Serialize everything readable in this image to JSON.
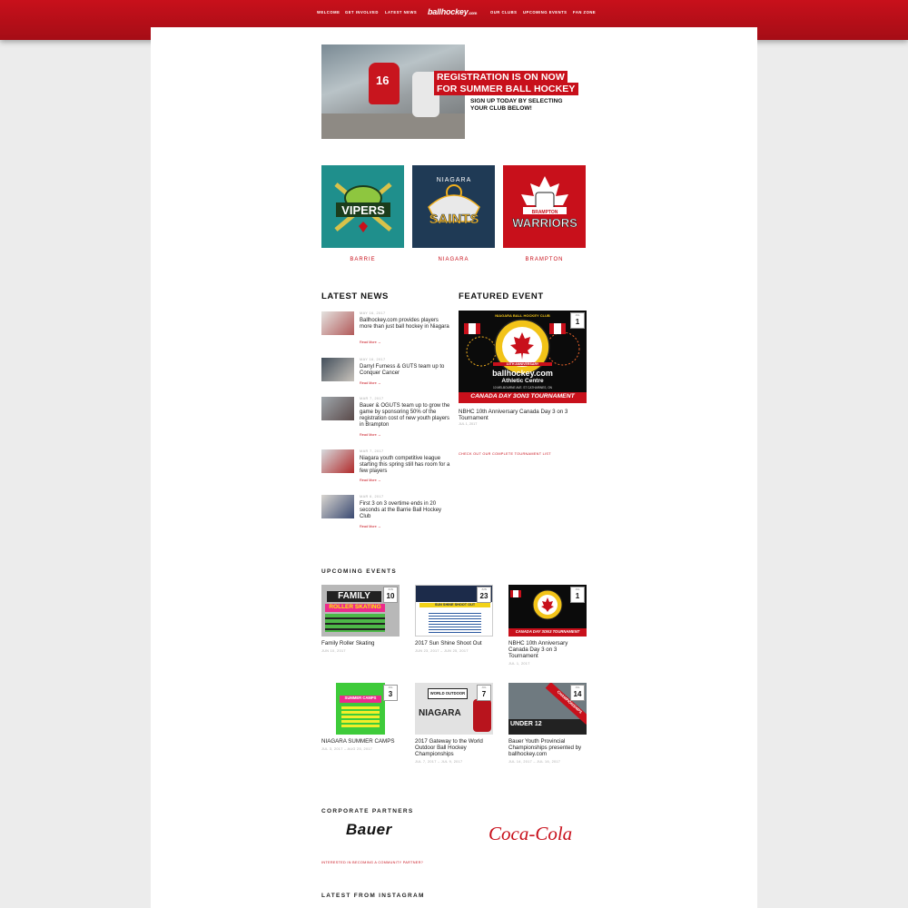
{
  "nav": {
    "left": [
      "WELCOME",
      "GET INVOLVED",
      "LATEST NEWS"
    ],
    "logo": "ballhockey",
    "logo_suffix": ".com",
    "right": [
      "OUR CLUBS",
      "UPCOMING EVENTS",
      "FAN ZONE"
    ]
  },
  "hero": {
    "line1": "REGISTRATION IS ON NOW",
    "line2": "FOR SUMMER BALL HOCKEY",
    "sub1": "SIGN UP TODAY BY SELECTING",
    "sub2": "YOUR CLUB BELOW!",
    "jersey_number": "16"
  },
  "clubs": [
    {
      "name": "BARRIE",
      "logo_text": "VIPERS",
      "bg": "#1f8f8c"
    },
    {
      "name": "NIAGARA",
      "logo_text": "SAINTS",
      "logo_top": "NIAGARA",
      "bg": "#1f3a55"
    },
    {
      "name": "BRAMPTON",
      "logo_text": "WARRIORS",
      "logo_top": "BRAMPTON",
      "bg": "#c8101b"
    }
  ],
  "latest_news": {
    "title": "LATEST NEWS",
    "items": [
      {
        "date": "MAY 16, 2017",
        "title": "Ballhockey.com provides players more than just ball hockey in Niagara",
        "more": "Read More →"
      },
      {
        "date": "MAY 16, 2017",
        "title": "Darryl Furness & GUTS team up to Conquer Cancer",
        "more": "Read More →"
      },
      {
        "date": "MAR 7, 2017",
        "title": "Bauer & OGUTS team up to grow the game by sponsoring 50% of the registration cost of new youth players in Brampton",
        "more": "Read More →"
      },
      {
        "date": "MAR 7, 2017",
        "title": "Niagara youth competitive league starting this spring still has room for a few players",
        "more": "Read More →"
      },
      {
        "date": "MAR 6, 2017",
        "title": "First 3 on 3 overtime ends in 20 seconds at the Barrie Ball Hockey Club",
        "more": "Read More →"
      }
    ]
  },
  "featured_event": {
    "title": "FEATURED EVENT",
    "badge_month": "JUL",
    "badge_day": "1",
    "poster_top": "NIAGARA BALL HOCKEY CLUB",
    "poster_anniv": "10TH ANNIVERSARY",
    "poster_brand": "ballhockey.com",
    "poster_venue": "Athletic Centre",
    "poster_address": "10 MELBOURNE AVE. ST CATHARINES, ON",
    "poster_banner": "CANADA DAY 3ON3 TOURNAMENT",
    "event_title": "NBHC 10th Anniversary Canada Day 3 on 3 Tournament",
    "event_date": "JUL 1, 2017",
    "link": "CHECK OUT OUR COMPLETE TOURNAMENT LIST"
  },
  "upcoming": {
    "title": "UPCOMING  EVENTS",
    "events": [
      {
        "month": "JUN",
        "day": "10",
        "title": "Family Roller Skating",
        "date": "JUN 10, 2017",
        "poster_head": "FAMILY",
        "poster_sub": "ROLLER SKATING"
      },
      {
        "month": "JUN",
        "day": "23",
        "title": "2017 Sun Shine Shoot Out",
        "date": "JUN 23, 2017 – JUN 25, 2017",
        "poster_head": "SUN SHINE SHOOT OUT",
        "poster_sub": ""
      },
      {
        "month": "JUL",
        "day": "1",
        "title": "NBHC 10th Anniversary Canada Day 3 on 3 Tournament",
        "date": "JUL 1, 2017",
        "poster_head": "CANADA DAY 3ON3 TOURNAMENT",
        "poster_sub": ""
      },
      {
        "month": "JUL",
        "day": "3",
        "title": "NIAGARA SUMMER CAMPS",
        "date": "JUL 3, 2017 – AUG 25, 2017",
        "poster_head": "SUMMER CAMPS",
        "poster_sub": ""
      },
      {
        "month": "JUL",
        "day": "7",
        "title": "2017 Gateway to the World Outdoor Ball Hockey Championships",
        "date": "JUL 7, 2017 – JUL 9, 2017",
        "poster_head": "WORLD OUTDOOR",
        "poster_sub": "NIAGARA"
      },
      {
        "month": "JUL",
        "day": "14",
        "title": "Bauer Youth Provincial Championships presented by ballhockey.com",
        "date": "JUL 14, 2017 – JUL 16, 2017",
        "poster_head": "UNDER 12",
        "poster_sub": "CHAMPIONSHIPS"
      }
    ]
  },
  "partners": {
    "title": "CORPORATE PARTNERS",
    "bauer": "Bauer",
    "coke": "Coca-Cola",
    "link": "INTERESTED IN BECOMING A COMMUNITY PARTNER?"
  },
  "instagram": {
    "title": "LATEST FROM INSTAGRAM"
  },
  "colors": {
    "accent": "#c8101b"
  }
}
